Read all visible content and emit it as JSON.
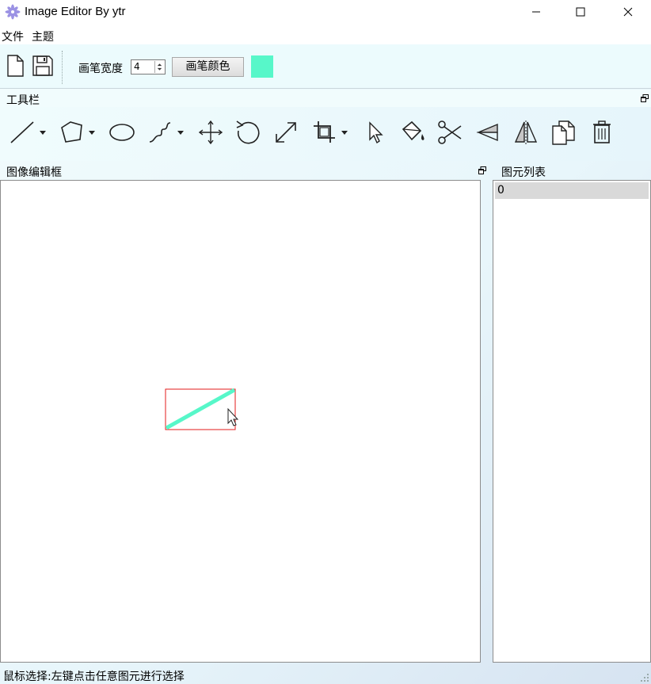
{
  "window": {
    "title": "Image Editor By ytr",
    "icon": "flower-icon"
  },
  "menu": {
    "items": [
      "文件",
      "主题"
    ]
  },
  "pen_toolbar": {
    "width_label": "画笔宽度",
    "width_value": "4",
    "color_button_label": "画笔颜色",
    "color": "#57f7c9"
  },
  "tools_dock": {
    "title": "工具栏",
    "tools": [
      "line-icon",
      "polygon-icon",
      "ellipse-icon",
      "curve-icon",
      "move-icon",
      "rotate-icon",
      "scale-icon",
      "crop-icon",
      "select-icon",
      "fill-icon",
      "cut-icon",
      "flip-horizontal-icon",
      "flip-vertical-icon",
      "copy-icon",
      "delete-icon"
    ]
  },
  "canvas_dock": {
    "title": "图像编辑框",
    "selection_color": "#e31b1b",
    "shape_color": "#57f7c9"
  },
  "element_list": {
    "title": "图元列表",
    "items": [
      "0"
    ]
  },
  "status": {
    "text": "鼠标选择:左键点击任意图元进行选择"
  }
}
